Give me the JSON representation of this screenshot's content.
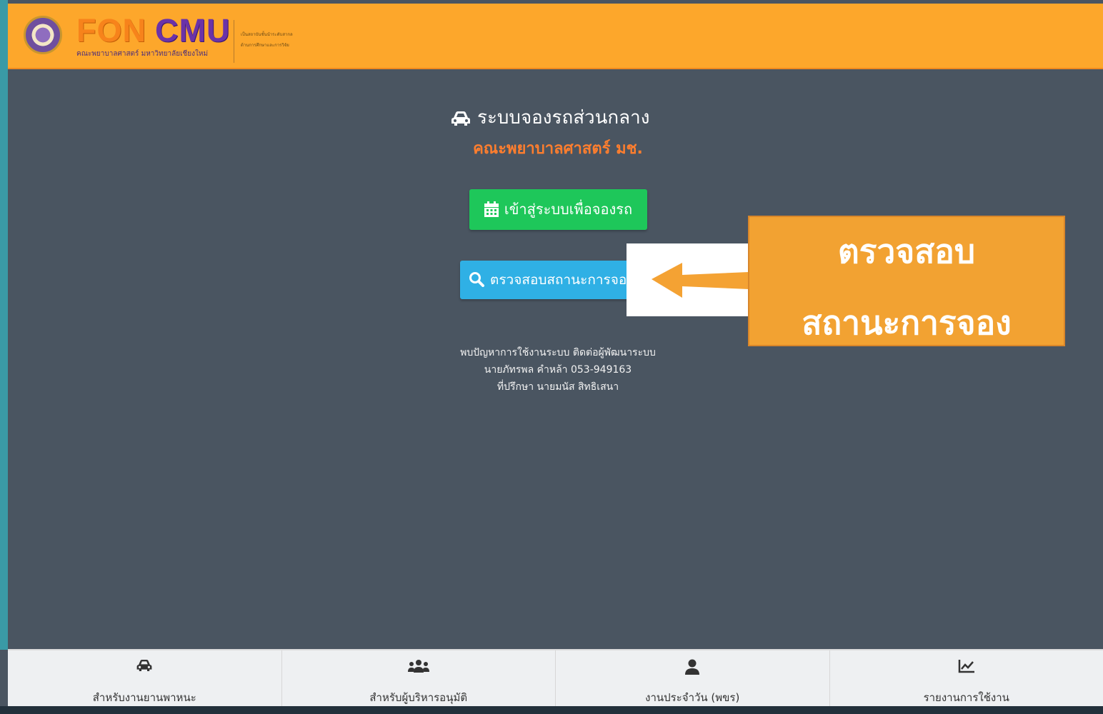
{
  "header": {
    "logo_fon": "FON",
    "logo_cmu": "CMU",
    "logo_subtitle": "คณะพยาบาลศาสตร์ มหาวิทยาลัยเชียงใหม่",
    "tagline_line1": "เป็นสถาบันชั้นนำระดับสากล",
    "tagline_line2": "ด้านการศึกษาและการวิจัย"
  },
  "main": {
    "title": "ระบบจองรถส่วนกลาง",
    "subtitle": "คณะพยาบาลศาสตร์ มช.",
    "book_button": "เข้าสู่ระบบเพื่อจองรถ",
    "check_button": "ตรวจสอบสถานะการจอง",
    "contact_line1": "พบปัญหาการใช้งานระบบ ติดต่อผู้พัฒนาระบบ",
    "contact_line2": "นายภัทรพล คำหล้า 053-949163",
    "contact_line3": "ที่ปรึกษา นายมนัส สิทธิเสนา"
  },
  "callout": {
    "line1": "ตรวจสอบ",
    "line2": "สถานะการจอง"
  },
  "footer": {
    "items": [
      {
        "label": "สำหรับงานยานพาหนะ",
        "icon": "car-icon"
      },
      {
        "label": "สำหรับผู้บริหารอนุมัติ",
        "icon": "users-icon"
      },
      {
        "label": "งานประจำวัน (พขร)",
        "icon": "user-icon"
      },
      {
        "label": "รายงานการใช้งาน",
        "icon": "chart-icon"
      }
    ]
  },
  "colors": {
    "header_bg": "#fda72b",
    "page_bg": "#4a5561",
    "book_button_bg": "#1ec75a",
    "check_button_bg": "#2fb0e5",
    "subtitle_color": "#ff7e2e",
    "callout_bg": "#f2a232"
  }
}
